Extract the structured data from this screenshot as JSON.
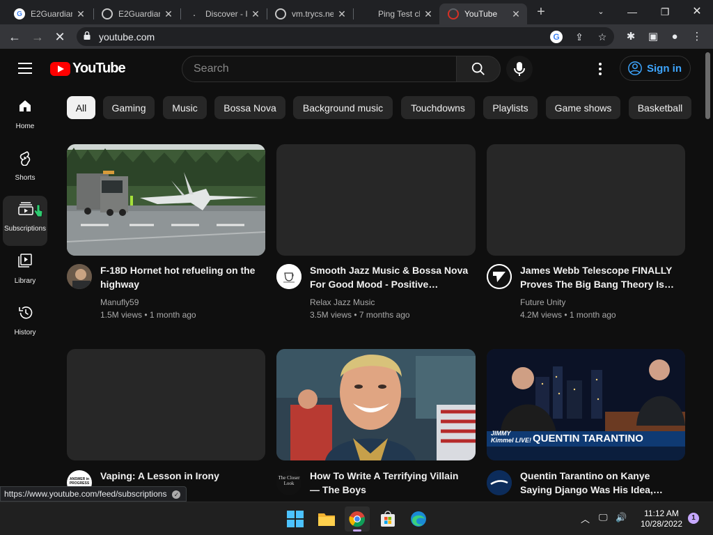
{
  "browser": {
    "tabs": [
      {
        "title": "E2Guardian",
        "favicon": "google-icon"
      },
      {
        "title": "E2Guardian",
        "favicon": "globe-icon"
      },
      {
        "title": "Discover - I",
        "favicon": "discover-icon"
      },
      {
        "title": "vm.trycs.ne",
        "favicon": "globe-icon"
      },
      {
        "title": "Ping Test cl",
        "favicon": "blank-icon"
      },
      {
        "title": "YouTube",
        "favicon": "youtube-icon"
      }
    ],
    "url": "youtube.com",
    "status_url": "https://www.youtube.com/feed/subscriptions"
  },
  "youtube": {
    "logo_text": "YouTube",
    "search_placeholder": "Search",
    "sign_in": "Sign in",
    "guide": [
      {
        "label": "Home",
        "icon": "home-icon"
      },
      {
        "label": "Shorts",
        "icon": "shorts-icon"
      },
      {
        "label": "Subscriptions",
        "icon": "subscriptions-icon"
      },
      {
        "label": "Library",
        "icon": "library-icon"
      },
      {
        "label": "History",
        "icon": "history-icon"
      }
    ],
    "chips": [
      "All",
      "Gaming",
      "Music",
      "Bossa Nova",
      "Background music",
      "Touchdowns",
      "Playlists",
      "Game shows",
      "Basketball"
    ],
    "videos": [
      {
        "title": "F-18D Hornet hot refueling on the highway",
        "channel": "Manufly59",
        "meta": "1.5M views • 1 month ago"
      },
      {
        "title": "Smooth Jazz Music & Bossa Nova For Good Mood - Positive…",
        "channel": "Relax Jazz Music",
        "meta": "3.5M views • 7 months ago"
      },
      {
        "title": "James Webb Telescope FINALLY Proves The Big Bang Theory Is…",
        "channel": "Future Unity",
        "meta": "4.2M views • 1 month ago"
      },
      {
        "title": "Vaping: A Lesson in Irony",
        "channel": "",
        "meta": "",
        "avatar_text": "ANSWER in PROGRESS"
      },
      {
        "title": "How To Write A Terrifying Villain — The Boys",
        "channel": "",
        "meta": "",
        "avatar_text": "The Closer Look"
      },
      {
        "title": "Quentin Tarantino on Kanye Saying Django Was His Idea,…",
        "channel": "",
        "meta": "",
        "thumb_text": "QUENTIN TARANTINO",
        "thumb_show": "JIMMY Kimmel LIVE!"
      }
    ]
  },
  "taskbar": {
    "time": "11:12 AM",
    "date": "10/28/2022",
    "notifications": "1"
  },
  "colors": {
    "background": "#0f0f0f",
    "chip": "#272727",
    "accent_blue": "#3ea6ff",
    "youtube_red": "#ff0000"
  }
}
